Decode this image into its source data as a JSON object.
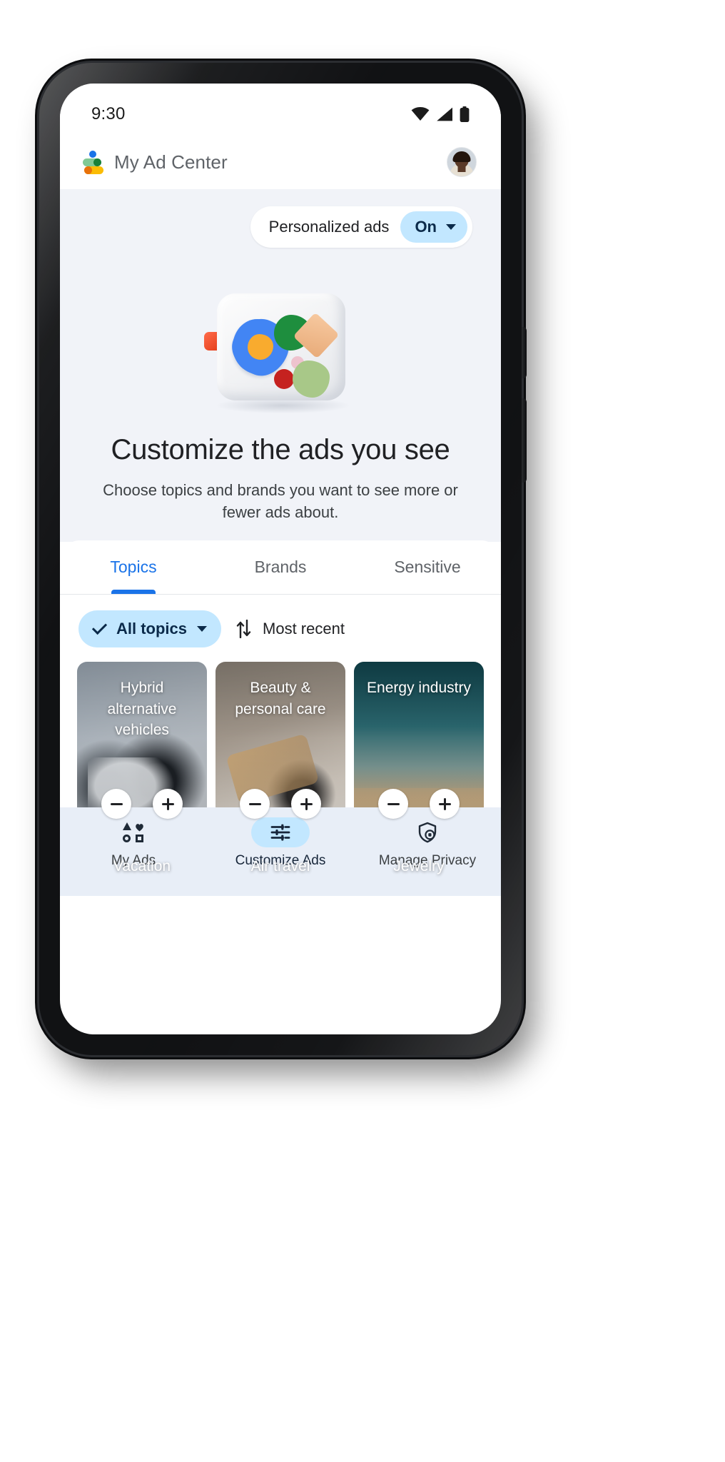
{
  "status_bar": {
    "time": "9:30",
    "icons": [
      "wifi-icon",
      "signal-icon",
      "battery-icon"
    ]
  },
  "app_bar": {
    "logo": "my-ad-center-logo",
    "title": "My Ad Center",
    "avatar": "user-avatar"
  },
  "hero": {
    "personalized_ads": {
      "label": "Personalized ads",
      "toggle_value": "On",
      "caret": "chevron-down-icon"
    },
    "illustration": "customize-ads-illustration",
    "title": "Customize the ads you see",
    "subtitle": "Choose topics and brands you want to see more or fewer ads about."
  },
  "tabs": [
    {
      "label": "Topics",
      "active": true
    },
    {
      "label": "Brands",
      "active": false
    },
    {
      "label": "Sensitive",
      "active": false
    }
  ],
  "filters": {
    "topic_filter": {
      "label": "All topics",
      "check": "check-icon",
      "caret": "chevron-down-icon"
    },
    "sort": {
      "icon": "sort-swap-icon",
      "label": "Most recent"
    }
  },
  "cards": [
    {
      "title": "Hybrid alternative vehicles",
      "art": "bg-ev",
      "minus": "−",
      "plus": "+"
    },
    {
      "title": "Beauty & personal care",
      "art": "bg-beauty",
      "minus": "−",
      "plus": "+"
    },
    {
      "title": "Energy industry",
      "art": "bg-energy",
      "minus": "−",
      "plus": "+"
    }
  ],
  "cards_row2": [
    {
      "title": "Vacation",
      "art": "bg-vacation"
    },
    {
      "title": "Air travel",
      "art": "bg-air"
    },
    {
      "title": "Jewelry",
      "art": "bg-jewelry"
    }
  ],
  "bottom_nav": [
    {
      "label": "My Ads",
      "icon": "shapes-icon",
      "active": false
    },
    {
      "label": "Customize Ads",
      "icon": "tune-icon",
      "active": true
    },
    {
      "label": "Manage Privacy",
      "icon": "shield-lock-icon",
      "active": false
    }
  ],
  "colors": {
    "accent_blue": "#1a73e8",
    "chip_blue": "#c2e7ff",
    "hero_bg": "#f1f3f8",
    "nav_bg": "#e8eef7",
    "text_primary": "#202124",
    "text_secondary": "#5f6368"
  }
}
